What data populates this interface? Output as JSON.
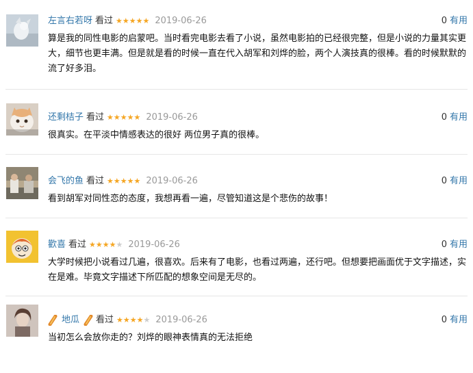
{
  "colors": {
    "username": "#3377aa",
    "star_on": "#f5a623",
    "star_off": "#cccccc",
    "time": "#999999",
    "divider": "#e6e6e6"
  },
  "comments": [
    {
      "username": "左言右若呀",
      "status": "看过",
      "rating": 5,
      "stars_on": "★★★★★",
      "stars_off": "",
      "time": "2019-06-26",
      "votes": "0",
      "vote_label": "有用",
      "content": "算是我的同性电影的启蒙吧。当时看完电影去看了小说，虽然电影拍的已经很完整，但是小说的力量其实更大，细节也更丰满。但是就是看的时候一直在代入胡军和刘烨的脸，两个人演技真的很棒。看的时候默默的流了好多泪。"
    },
    {
      "username": "还剩桔子",
      "status": "看过",
      "rating": 5,
      "stars_on": "★★★★★",
      "stars_off": "",
      "time": "2019-06-26",
      "votes": "0",
      "vote_label": "有用",
      "content": "很真实。在平淡中情感表达的很好 两位男子真的很棒。"
    },
    {
      "username": "会飞的鱼",
      "status": "看过",
      "rating": 5,
      "stars_on": "★★★★★",
      "stars_off": "",
      "time": "2019-06-26",
      "votes": "0",
      "vote_label": "有用",
      "content": "看到胡军对同性恋的态度，我想再看一遍，尽管知道这是个悲伤的故事！"
    },
    {
      "username": "歡喜",
      "status": "看过",
      "rating": 4,
      "stars_on": "★★★★",
      "stars_off": "★",
      "time": "2019-06-26",
      "votes": "0",
      "vote_label": "有用",
      "content": "大学时候把小说看过几遍，很喜欢。后来有了电影，也看过两遍，还行吧。但想要把画面优于文字描述，实在是难。毕竟文字描述下所匹配的想象空间是无尽的。"
    },
    {
      "username": "地瓜",
      "status": "看过",
      "rating": 4,
      "stars_on": "★★★★",
      "stars_off": "★",
      "time": "2019-06-26",
      "votes": "0",
      "vote_label": "有用",
      "content": "当初怎么会放你走的？刘烨的眼神表情真的无法拒绝"
    }
  ]
}
